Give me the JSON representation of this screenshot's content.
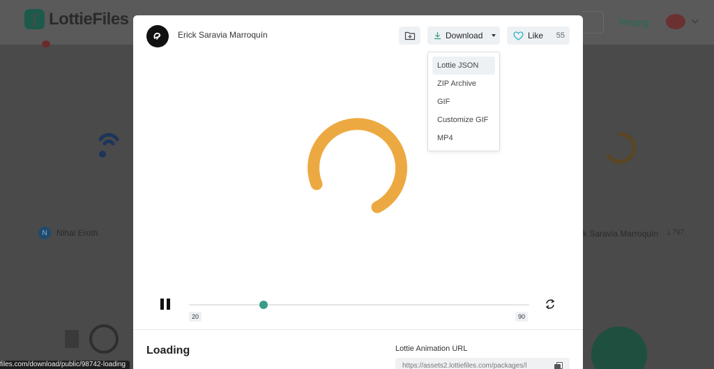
{
  "background": {
    "logo_text": "LottieFiles",
    "pricing_label": "Pricing",
    "card_left_author": "Nihal Eroth",
    "card_left_initial": "N",
    "card_right_author": "k Saravia Marroquín",
    "card_right_downloads": "797"
  },
  "modal": {
    "author_name": "Erick Saravia Marroquín",
    "download_label": "Download",
    "like_label": "Like",
    "like_count": "55",
    "dropdown_items": [
      "Lottie JSON",
      "ZIP Archive",
      "GIF",
      "Customize GIF",
      "MP4"
    ],
    "player": {
      "frame_start": "20",
      "frame_end": "90",
      "progress": 0.22
    },
    "animation_title": "Loading",
    "url_label": "Lottie Animation URL",
    "url_value": "https://assets2.lottiefiles.com/packages/l"
  },
  "status_bar_url": "files.com/download/public/98742-loading",
  "colors": {
    "accent": "#3a9b86",
    "spinner": "#eda941",
    "like_heart": "#2bb3c0"
  }
}
